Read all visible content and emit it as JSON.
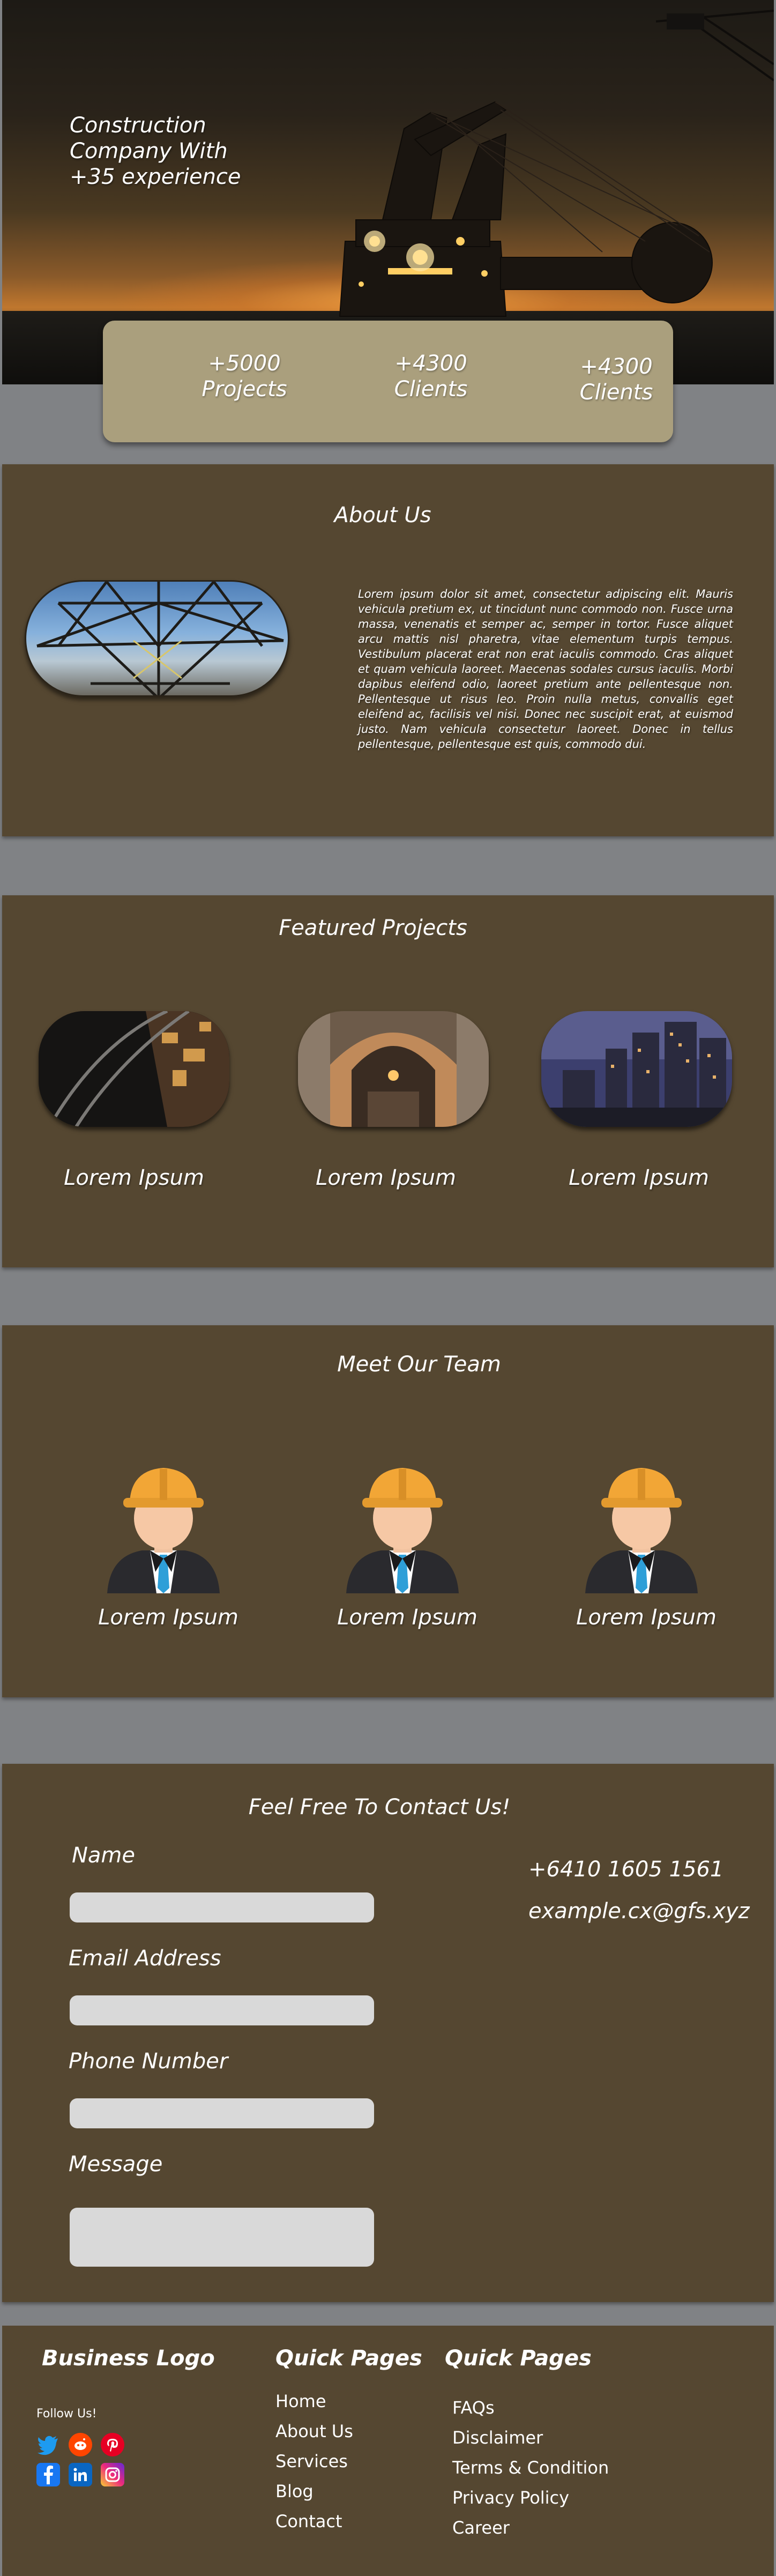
{
  "hero": {
    "title": "Construction Company With +35 experience"
  },
  "stats": [
    {
      "value": "+5000",
      "label": "Projects"
    },
    {
      "value": "+4300",
      "label": "Clients"
    },
    {
      "value": "+4300",
      "label": "Clients"
    }
  ],
  "about": {
    "title": "About Us",
    "text": "Lorem ipsum dolor sit amet, consectetur adipiscing elit. Mauris vehicula pretium ex, ut tincidunt nunc commodo non. Fusce urna massa, venenatis et semper ac, semper in tortor. Fusce aliquet arcu mattis nisl pharetra, vitae elementum turpis tempus. Vestibulum placerat erat non erat iaculis commodo. Cras aliquet et quam vehicula laoreet. Maecenas sodales cursus iaculis. Morbi dapibus eleifend odio, laoreet pretium ante pellentesque non. Pellentesque ut risus leo. Proin nulla metus, convallis eget eleifend ac, facilisis vel nisi. Donec nec suscipit erat, at euismod justo. Nam vehicula consectetur laoreet. Donec in tellus pellentesque, pellentesque est quis, commodo dui."
  },
  "projects": {
    "title": "Featured Projects",
    "items": [
      {
        "label": "Lorem Ipsum"
      },
      {
        "label": "Lorem Ipsum"
      },
      {
        "label": "Lorem Ipsum"
      }
    ]
  },
  "team": {
    "title": "Meet Our Team",
    "members": [
      {
        "label": "Lorem Ipsum"
      },
      {
        "label": "Lorem Ipsum"
      },
      {
        "label": "Lorem Ipsum"
      }
    ]
  },
  "contact": {
    "title": "Feel Free To Contact Us!",
    "fields": {
      "name": {
        "label": "Name",
        "value": ""
      },
      "email": {
        "label": "Email Address",
        "value": ""
      },
      "phone": {
        "label": "Phone Number",
        "value": ""
      },
      "message": {
        "label": "Message",
        "value": ""
      }
    },
    "phone": "+6410 1605 1561",
    "email": "example.cx@gfs.xyz"
  },
  "footer": {
    "logo": "Business Logo",
    "follow": "Follow Us!",
    "quick_pages_1": {
      "title": "Quick Pages",
      "links": [
        "Home",
        "About Us",
        "Services",
        "Blog",
        "Contact"
      ]
    },
    "quick_pages_2": {
      "title": "Quick Pages",
      "links": [
        "FAQs",
        "Disclaimer",
        "Terms & Condition",
        "Privacy Policy",
        "Career"
      ]
    },
    "social_icons": [
      "twitter-icon",
      "reddit-icon",
      "pinterest-icon",
      "facebook-icon",
      "linkedin-icon",
      "instagram-icon"
    ]
  },
  "colors": {
    "page_background": "#808285",
    "section_background": "#554731",
    "stats_card": "#aa9f7d",
    "input_background": "#d9d9d9",
    "helmet": "#f2a636",
    "tie": "#2e9fd8"
  }
}
